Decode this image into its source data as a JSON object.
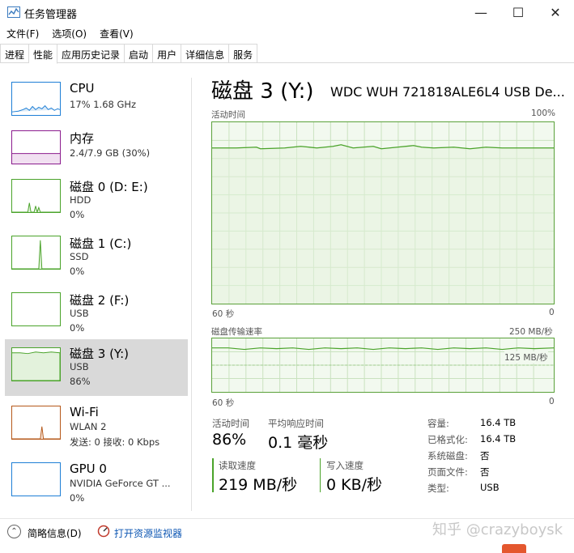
{
  "window": {
    "title": "任务管理器",
    "minimize_glyph": "—",
    "maximize_glyph": "☐",
    "close_glyph": "✕"
  },
  "menu": [
    "文件(F)",
    "选项(O)",
    "查看(V)"
  ],
  "tabs": [
    "进程",
    "性能",
    "应用历史记录",
    "启动",
    "用户",
    "详细信息",
    "服务"
  ],
  "active_tab": "性能",
  "devices": [
    {
      "name": "CPU",
      "line1": "17% 1.68 GHz",
      "line2": "",
      "color": "#1e7fd6"
    },
    {
      "name": "内存",
      "line1": "2.4/7.9 GB (30%)",
      "line2": "",
      "color": "#8b1c8e"
    },
    {
      "name": "磁盘 0 (D: E:)",
      "line1": "HDD",
      "line2": "0%",
      "color": "#4aa32a"
    },
    {
      "name": "磁盘 1 (C:)",
      "line1": "SSD",
      "line2": "0%",
      "color": "#4aa32a"
    },
    {
      "name": "磁盘 2 (F:)",
      "line1": "USB",
      "line2": "0%",
      "color": "#4aa32a"
    },
    {
      "name": "磁盘 3 (Y:)",
      "line1": "USB",
      "line2": "86%",
      "color": "#4aa32a"
    },
    {
      "name": "Wi-Fi",
      "line1": "WLAN 2",
      "line2": "发送: 0  接收: 0 Kbps",
      "color": "#b5581a"
    },
    {
      "name": "GPU 0",
      "line1": "NVIDIA GeForce GT ...",
      "line2": "0%",
      "color": "#1e7fd6"
    }
  ],
  "selected_device": "磁盘 3 (Y:)",
  "detail": {
    "title": "磁盘 3 (Y:)",
    "model": "WDC  WUH 721818ALE6L4 USB De...",
    "graph1": {
      "label": "活动时间",
      "max": "100%",
      "time": "60 秒",
      "min": "0"
    },
    "graph2": {
      "label": "磁盘传输速率",
      "max": "250 MB/秒",
      "mid": "125 MB/秒",
      "time": "60 秒",
      "min": "0"
    },
    "stats": {
      "active_label": "活动时间",
      "active_value": "86%",
      "resp_label": "平均响应时间",
      "resp_value": "0.1 毫秒",
      "read_label": "读取速度",
      "read_value": "219 MB/秒",
      "write_label": "写入速度",
      "write_value": "0 KB/秒"
    },
    "props": [
      {
        "label": "容量:",
        "value": "16.4 TB"
      },
      {
        "label": "已格式化:",
        "value": "16.4 TB"
      },
      {
        "label": "系统磁盘:",
        "value": "否"
      },
      {
        "label": "页面文件:",
        "value": "否"
      },
      {
        "label": "类型:",
        "value": "USB"
      }
    ]
  },
  "footer": {
    "fewer_details": "简略信息(D)",
    "open_monitor": "打开资源监视器"
  },
  "watermark": "知乎 @crazyboysk",
  "colors": {
    "disk_green": "#4aa32a",
    "graph_fill": "#f2f9ef",
    "selected_bg": "#d9d9d9",
    "link": "#0e57b3"
  }
}
